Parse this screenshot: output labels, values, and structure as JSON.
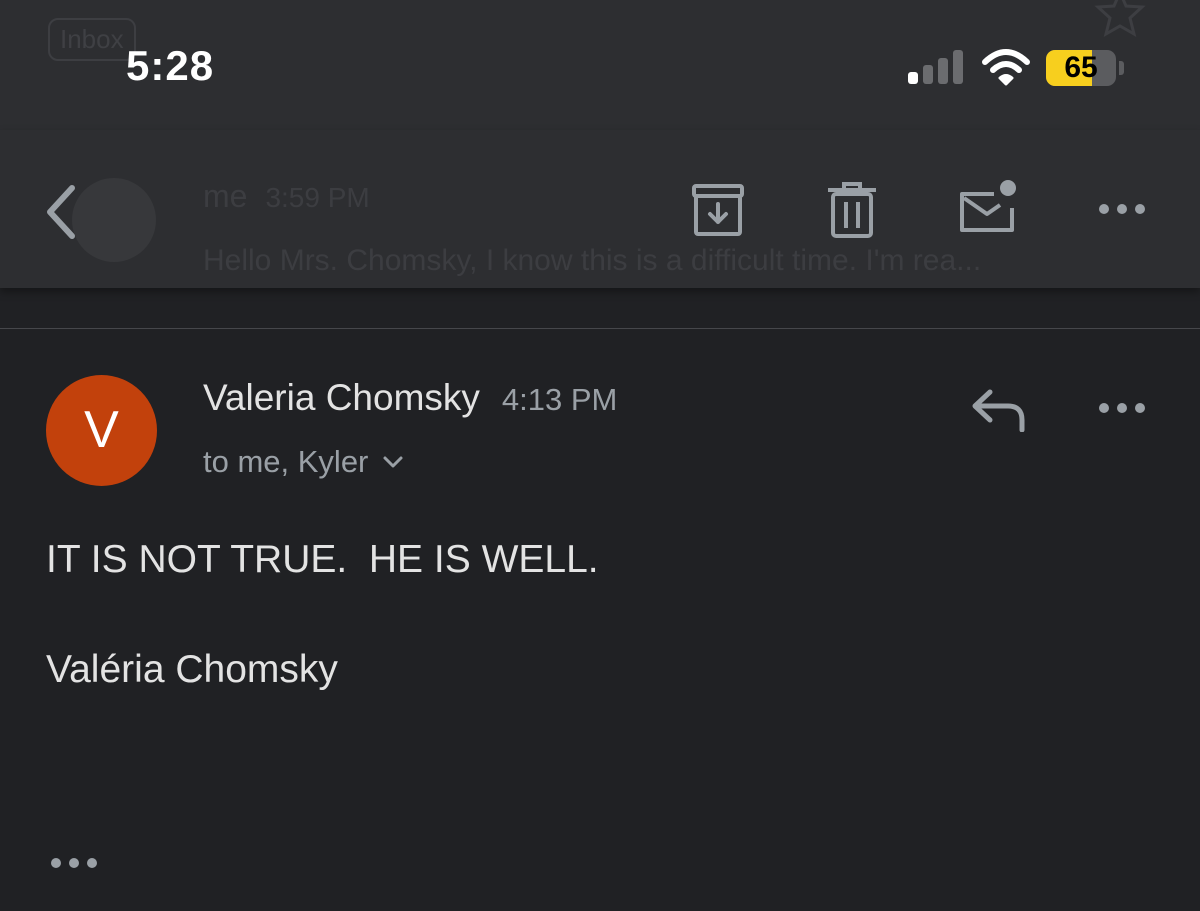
{
  "status_bar": {
    "time": "5:28",
    "battery_percent": 65,
    "signal_bars_active": 1,
    "signal_bars_total": 4
  },
  "background": {
    "label": "Inbox"
  },
  "toolbar": {
    "behind_sender": "me",
    "behind_time": "3:59 PM",
    "behind_snippet": "Hello Mrs. Chomsky, I know this is a difficult time. I'm rea..."
  },
  "message": {
    "avatar_letter": "V",
    "avatar_color": "#c2410c",
    "sender": "Valeria Chomsky",
    "time": "4:13 PM",
    "recipients": "to me, Kyler",
    "body_line_1": "IT IS NOT TRUE.  HE IS WELL.",
    "body_line_2": "Valéria Chomsky"
  },
  "icons": [
    "back-chevron-icon",
    "archive-icon",
    "trash-icon",
    "mark-unread-icon",
    "more-icon",
    "reply-icon",
    "chevron-down-icon"
  ]
}
